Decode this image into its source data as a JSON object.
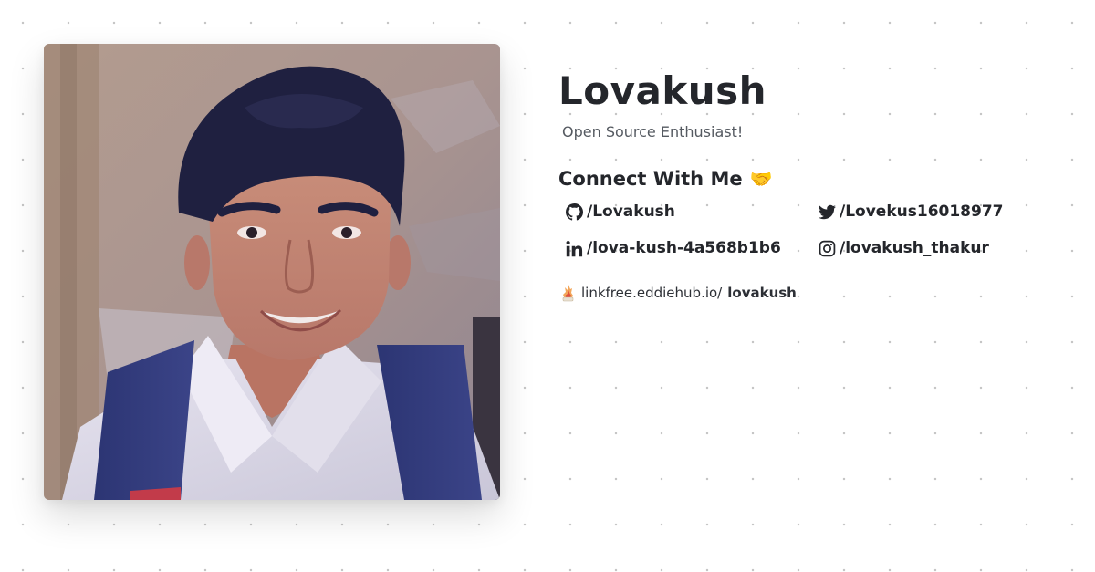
{
  "profile": {
    "name": "Lovakush",
    "tagline": "Open Source Enthusiast!",
    "photo_icon": "profile-photo"
  },
  "connect": {
    "heading": "Connect With Me",
    "heading_emoji": "🤝"
  },
  "socials": [
    {
      "platform": "GitHub",
      "icon": "github-icon",
      "handle": "/Lovakush"
    },
    {
      "platform": "Twitter",
      "icon": "twitter-icon",
      "handle": "/Lovekus16018977"
    },
    {
      "platform": "LinkedIn",
      "icon": "linkedin-icon",
      "handle": "/lova-kush-4a568b1b6"
    },
    {
      "platform": "Instagram",
      "icon": "instagram-icon",
      "handle": "/lovakush_thakur"
    }
  ],
  "linkfree": {
    "icon": "linkfree-logo-icon",
    "prefix": "linkfree.eddiehub.io/",
    "username": "lovakush"
  },
  "colors": {
    "text": "#24262b",
    "muted": "#555a61",
    "background": "#ffffff",
    "dots": "#c4c4c4"
  }
}
